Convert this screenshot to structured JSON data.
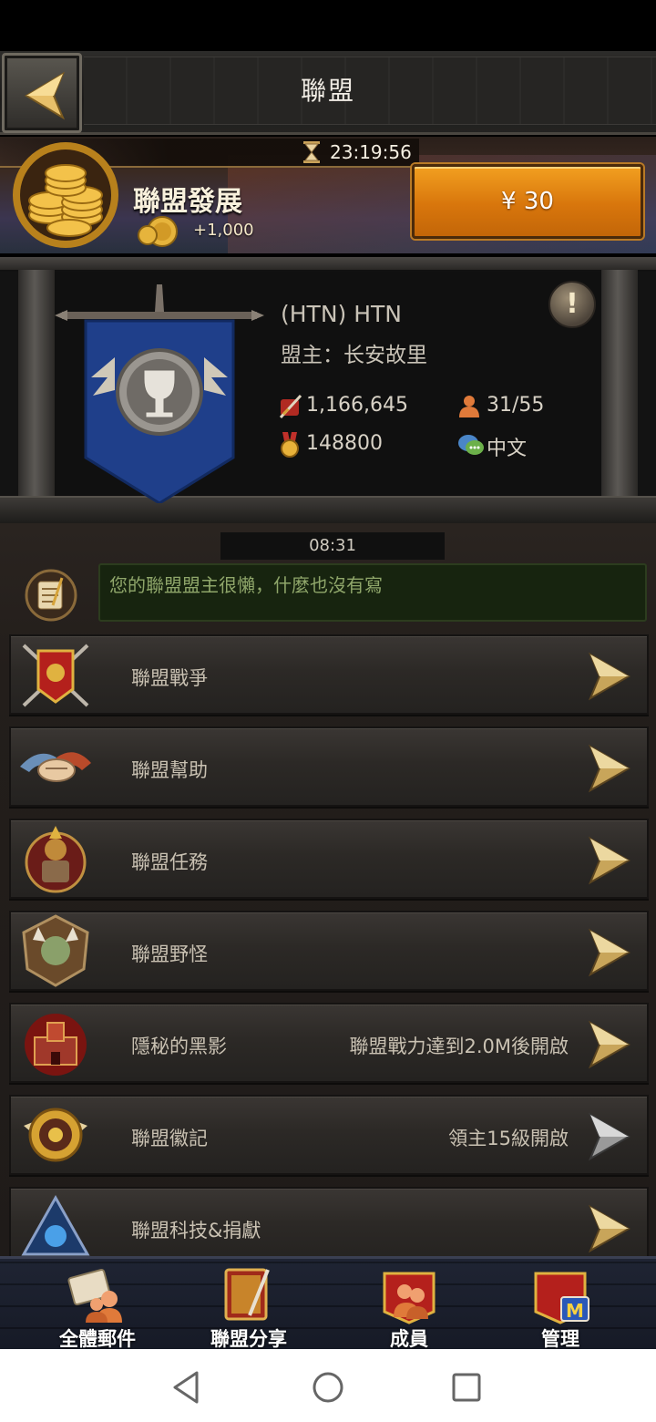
{
  "header": {
    "title": "聯盟"
  },
  "development": {
    "timer": "23:19:56",
    "title": "聯盟發展",
    "reward": "+1,000",
    "price_label": "¥ 30"
  },
  "alliance": {
    "name": "(HTN) HTN",
    "leader": "盟主：长安故里",
    "power": "1,166,645",
    "members": "31/55",
    "honor": "148800",
    "language": "中文",
    "info_symbol": "!"
  },
  "notice": {
    "time": "08:31",
    "text": "您的聯盟盟主很懶，什麼也沒有寫"
  },
  "menu": [
    {
      "label": "聯盟戰爭",
      "status": "",
      "icon": "war-banner-icon"
    },
    {
      "label": "聯盟幫助",
      "status": "",
      "icon": "handshake-icon"
    },
    {
      "label": "聯盟任務",
      "status": "",
      "icon": "dwarf-warrior-icon"
    },
    {
      "label": "聯盟野怪",
      "status": "",
      "icon": "monster-icon"
    },
    {
      "label": "隱秘的黑影",
      "status": "聯盟戰力達到2.0M後開啟",
      "icon": "fortress-icon"
    },
    {
      "label": "聯盟徽記",
      "status": "領主15級開啟",
      "icon": "emblem-icon"
    },
    {
      "label": "聯盟科技&捐獻",
      "status": "",
      "icon": "tech-icon"
    }
  ],
  "bottom_nav": [
    {
      "label": "全體郵件",
      "icon": "mail-icon"
    },
    {
      "label": "聯盟分享",
      "icon": "share-book-icon"
    },
    {
      "label": "成員",
      "icon": "members-icon"
    },
    {
      "label": "管理",
      "icon": "manage-icon",
      "badge": "M"
    }
  ],
  "colors": {
    "accent_orange": "#e08816",
    "notice_text": "#8fa66a",
    "panel_blue": "#1f3f8a"
  }
}
